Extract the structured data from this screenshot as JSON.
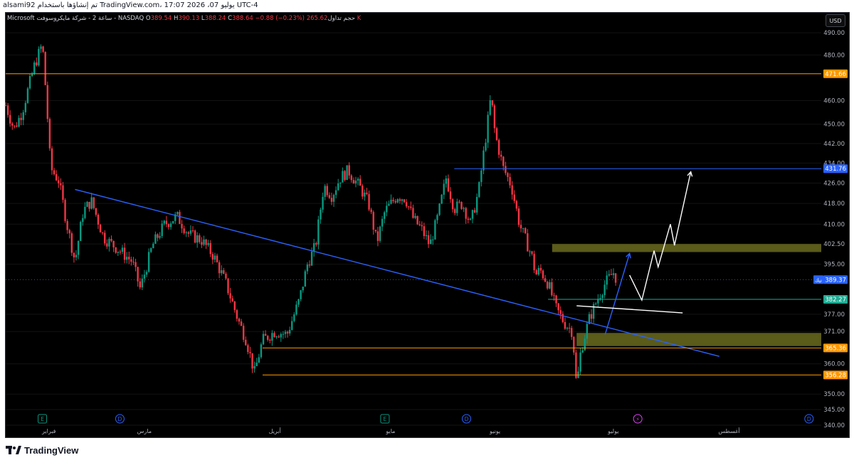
{
  "topbar": {
    "left": "alsami92 تم إنشاؤها باستخدام TradingView.com، 17:07 2026 ،يوليو 07 UTC-4"
  },
  "legend": {
    "symbol": "Microsoft ساعة 2 - شركة مايكروسوفت - NASDAQ",
    "open_label": "O",
    "open": "389.54",
    "high_label": "H",
    "high": "390.13",
    "low_label": "L",
    "low": "388.24",
    "close_label": "C",
    "close": "388.64",
    "change": "−0.88 (−0.23%)",
    "volume_label": "حجم تداول",
    "volume": "265.62 K"
  },
  "currency_button": "USD",
  "footer": {
    "logo_text": "TradingView"
  },
  "colors": {
    "up": "#089981",
    "down": "#f23645",
    "orange_line": "#ff9800",
    "blue_line": "#2962ff",
    "green_line": "#22ab94",
    "zone": "#6b6b1f",
    "grid": "#131313",
    "axis_text": "#b2b5be"
  },
  "chart_data": {
    "type": "candlestick",
    "y_ticks": [
      "490.00",
      "480.00",
      "471.66",
      "460.00",
      "450.00",
      "442.00",
      "434.00",
      "426.00",
      "418.00",
      "410.00",
      "402.50",
      "395.00",
      "389.37",
      "382.27",
      "377.00",
      "371.00",
      "365.36",
      "360.00",
      "356.28",
      "350.00",
      "345.00",
      "340.00"
    ],
    "ylim": [
      340,
      492
    ],
    "y_scale": "log",
    "x_labels": [
      "فبراير",
      "مارس",
      "أبريل",
      "مايو",
      "يونيو",
      "يوليو",
      "أغسطس"
    ],
    "price_labels": [
      {
        "value": 471.66,
        "text": "471.66",
        "color": "#ff9800",
        "kind": "hline"
      },
      {
        "value": 431.76,
        "text": "431.76",
        "color": "#2962ff",
        "kind": "hline"
      },
      {
        "value": 389.37,
        "text": "389.37",
        "color": "#2962ff",
        "kind": "last",
        "tag": "نيك"
      },
      {
        "value": 382.27,
        "text": "382.27",
        "color": "#22ab94",
        "kind": "hline"
      },
      {
        "value": 365.36,
        "text": "365.36",
        "color": "#ff9800",
        "kind": "hline"
      },
      {
        "value": 356.28,
        "text": "356.28",
        "color": "#ff9800",
        "kind": "hline"
      }
    ],
    "event_markers": [
      {
        "label": "E",
        "color": "#089981",
        "kind": "earnings"
      },
      {
        "label": "D",
        "color": "#2962ff",
        "kind": "dividend"
      },
      {
        "label": "E",
        "color": "#089981",
        "kind": "earnings"
      },
      {
        "label": "D",
        "color": "#2962ff",
        "kind": "dividend"
      },
      {
        "label": "⚡",
        "color": "#e040fb",
        "kind": "split"
      },
      {
        "label": "D",
        "color": "#2962ff",
        "kind": "dividend"
      }
    ],
    "price_path": [
      [
        0.0,
        458
      ],
      [
        0.01,
        448
      ],
      [
        0.02,
        455
      ],
      [
        0.035,
        475
      ],
      [
        0.045,
        485
      ],
      [
        0.05,
        460
      ],
      [
        0.055,
        432
      ],
      [
        0.065,
        427
      ],
      [
        0.075,
        410
      ],
      [
        0.085,
        396
      ],
      [
        0.095,
        415
      ],
      [
        0.105,
        419
      ],
      [
        0.12,
        405
      ],
      [
        0.14,
        400
      ],
      [
        0.155,
        396
      ],
      [
        0.165,
        386
      ],
      [
        0.18,
        402
      ],
      [
        0.195,
        410
      ],
      [
        0.21,
        413
      ],
      [
        0.225,
        406
      ],
      [
        0.24,
        404
      ],
      [
        0.255,
        398
      ],
      [
        0.27,
        388
      ],
      [
        0.285,
        375
      ],
      [
        0.295,
        368
      ],
      [
        0.305,
        357
      ],
      [
        0.315,
        368
      ],
      [
        0.33,
        371
      ],
      [
        0.345,
        370
      ],
      [
        0.36,
        382
      ],
      [
        0.37,
        395
      ],
      [
        0.38,
        402
      ],
      [
        0.39,
        425
      ],
      [
        0.4,
        421
      ],
      [
        0.41,
        428
      ],
      [
        0.42,
        431
      ],
      [
        0.435,
        424
      ],
      [
        0.445,
        418
      ],
      [
        0.455,
        403
      ],
      [
        0.465,
        415
      ],
      [
        0.48,
        421
      ],
      [
        0.49,
        420
      ],
      [
        0.5,
        412
      ],
      [
        0.51,
        408
      ],
      [
        0.52,
        402
      ],
      [
        0.53,
        413
      ],
      [
        0.54,
        428
      ],
      [
        0.55,
        416
      ],
      [
        0.56,
        418
      ],
      [
        0.57,
        410
      ],
      [
        0.58,
        423
      ],
      [
        0.59,
        448
      ],
      [
        0.595,
        462
      ],
      [
        0.6,
        446
      ],
      [
        0.61,
        432
      ],
      [
        0.62,
        425
      ],
      [
        0.63,
        410
      ],
      [
        0.64,
        402
      ],
      [
        0.645,
        398
      ],
      [
        0.65,
        391
      ],
      [
        0.655,
        393
      ],
      [
        0.665,
        388
      ],
      [
        0.675,
        379
      ],
      [
        0.685,
        374
      ],
      [
        0.695,
        371
      ],
      [
        0.7,
        352
      ],
      [
        0.705,
        364
      ],
      [
        0.715,
        375
      ],
      [
        0.725,
        382
      ],
      [
        0.735,
        388
      ],
      [
        0.745,
        392
      ],
      [
        0.75,
        389
      ]
    ],
    "series": [
      {
        "name": "",
        "values": []
      }
    ],
    "drawings": [
      {
        "kind": "trendline",
        "color": "#2962ff",
        "points": [
          [
            0.085,
            423.5
          ],
          [
            0.875,
            362.5
          ]
        ]
      },
      {
        "kind": "hline_segment",
        "color": "#2962ff",
        "from": 0.55,
        "price": 431.76
      },
      {
        "kind": "hline_full",
        "color": "#ff9800",
        "price": 471.66
      },
      {
        "kind": "hline_segment",
        "color": "#22ab94",
        "from": 0.665,
        "price": 382.27
      },
      {
        "kind": "hline_segment",
        "color": "#ff9800",
        "from": 0.315,
        "price": 365.36
      },
      {
        "kind": "hline_segment",
        "color": "#ff9800",
        "from": 0.315,
        "price": 356.28
      },
      {
        "kind": "zone",
        "color": "#6b6b1f",
        "from": 0.67,
        "to": 1.0,
        "top": 402.5,
        "bottom": 399.5
      },
      {
        "kind": "zone",
        "color": "#6b6b1f",
        "from": 0.7,
        "to": 1.0,
        "top": 370.5,
        "bottom": 366.0
      },
      {
        "kind": "polyline",
        "color": "#2962ff",
        "points": [
          [
            0.735,
            370
          ],
          [
            0.765,
            399
          ]
        ]
      },
      {
        "kind": "polyline",
        "color": "#ffffff",
        "points": [
          [
            0.765,
            391
          ],
          [
            0.78,
            382
          ],
          [
            0.795,
            400
          ],
          [
            0.8,
            394
          ],
          [
            0.815,
            410
          ],
          [
            0.82,
            402
          ],
          [
            0.84,
            430.5
          ]
        ]
      },
      {
        "kind": "polyline",
        "color": "#ffffff",
        "points": [
          [
            0.7,
            380
          ],
          [
            0.83,
            377.5
          ]
        ]
      }
    ]
  }
}
